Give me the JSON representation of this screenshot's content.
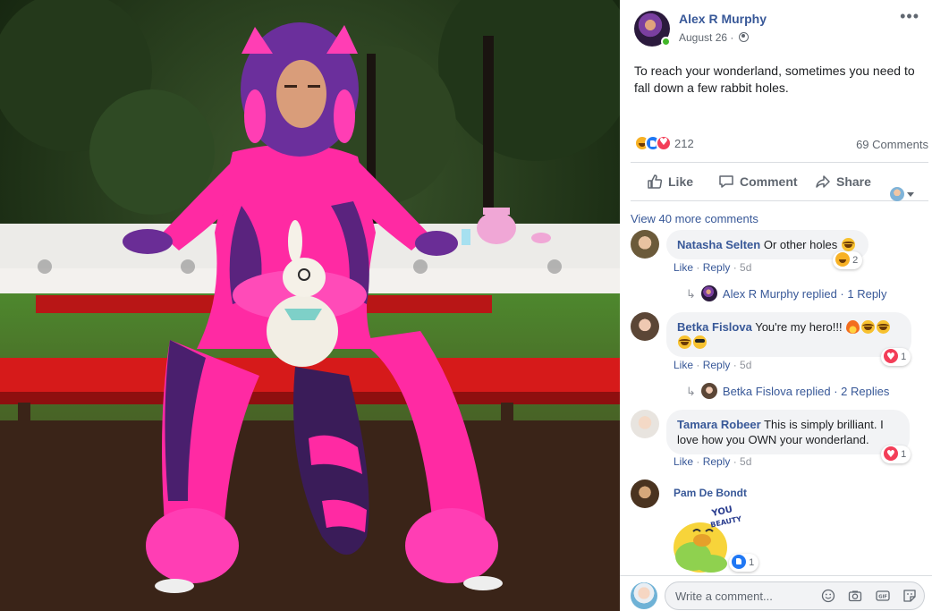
{
  "post": {
    "author": "Alex R Murphy",
    "date": "August 26 ·",
    "text": "To reach your wonderland, sometimes you need to fall down a few rabbit holes.",
    "more_icon": "more-dots-icon",
    "privacy_icon": "globe-icon",
    "online": true
  },
  "stats": {
    "reaction_count": "212",
    "comments_count": "69 Comments",
    "reaction_types": [
      "haha",
      "like",
      "love"
    ]
  },
  "actions": {
    "like": "Like",
    "comment": "Comment",
    "share": "Share"
  },
  "comments": {
    "view_more": "View 40 more comments",
    "items": [
      {
        "name": "Natasha Selten",
        "text": "Or other holes",
        "meta_like": "Like",
        "meta_reply": "Reply",
        "meta_time": "5d",
        "reaction_count": "2",
        "reply_summary_name": "Alex R Murphy replied",
        "reply_summary_count": "1 Reply"
      },
      {
        "name": "Betka Fislova",
        "text": "You're my hero!!!",
        "meta_like": "Like",
        "meta_reply": "Reply",
        "meta_time": "5d",
        "reaction_count": "1",
        "reply_summary_name": "Betka Fislova replied",
        "reply_summary_count": "2 Replies"
      },
      {
        "name": "Tamara Robeer",
        "text": "This is simply brilliant. I love how you OWN your wonderland.",
        "meta_like": "Like",
        "meta_reply": "Reply",
        "meta_time": "5d",
        "reaction_count": "1"
      },
      {
        "name": "Pam De Bondt",
        "sticker": "You beauty! bird sticker",
        "reaction_count": "1"
      }
    ]
  },
  "compose": {
    "placeholder": "Write a comment...",
    "icons": [
      "emoji-icon",
      "camera-icon",
      "gif-icon",
      "sticker-icon"
    ]
  },
  "colors": {
    "link": "#385898",
    "secondary_text": "#606770",
    "bubble": "#f2f3f5",
    "divider": "#dadde1"
  }
}
